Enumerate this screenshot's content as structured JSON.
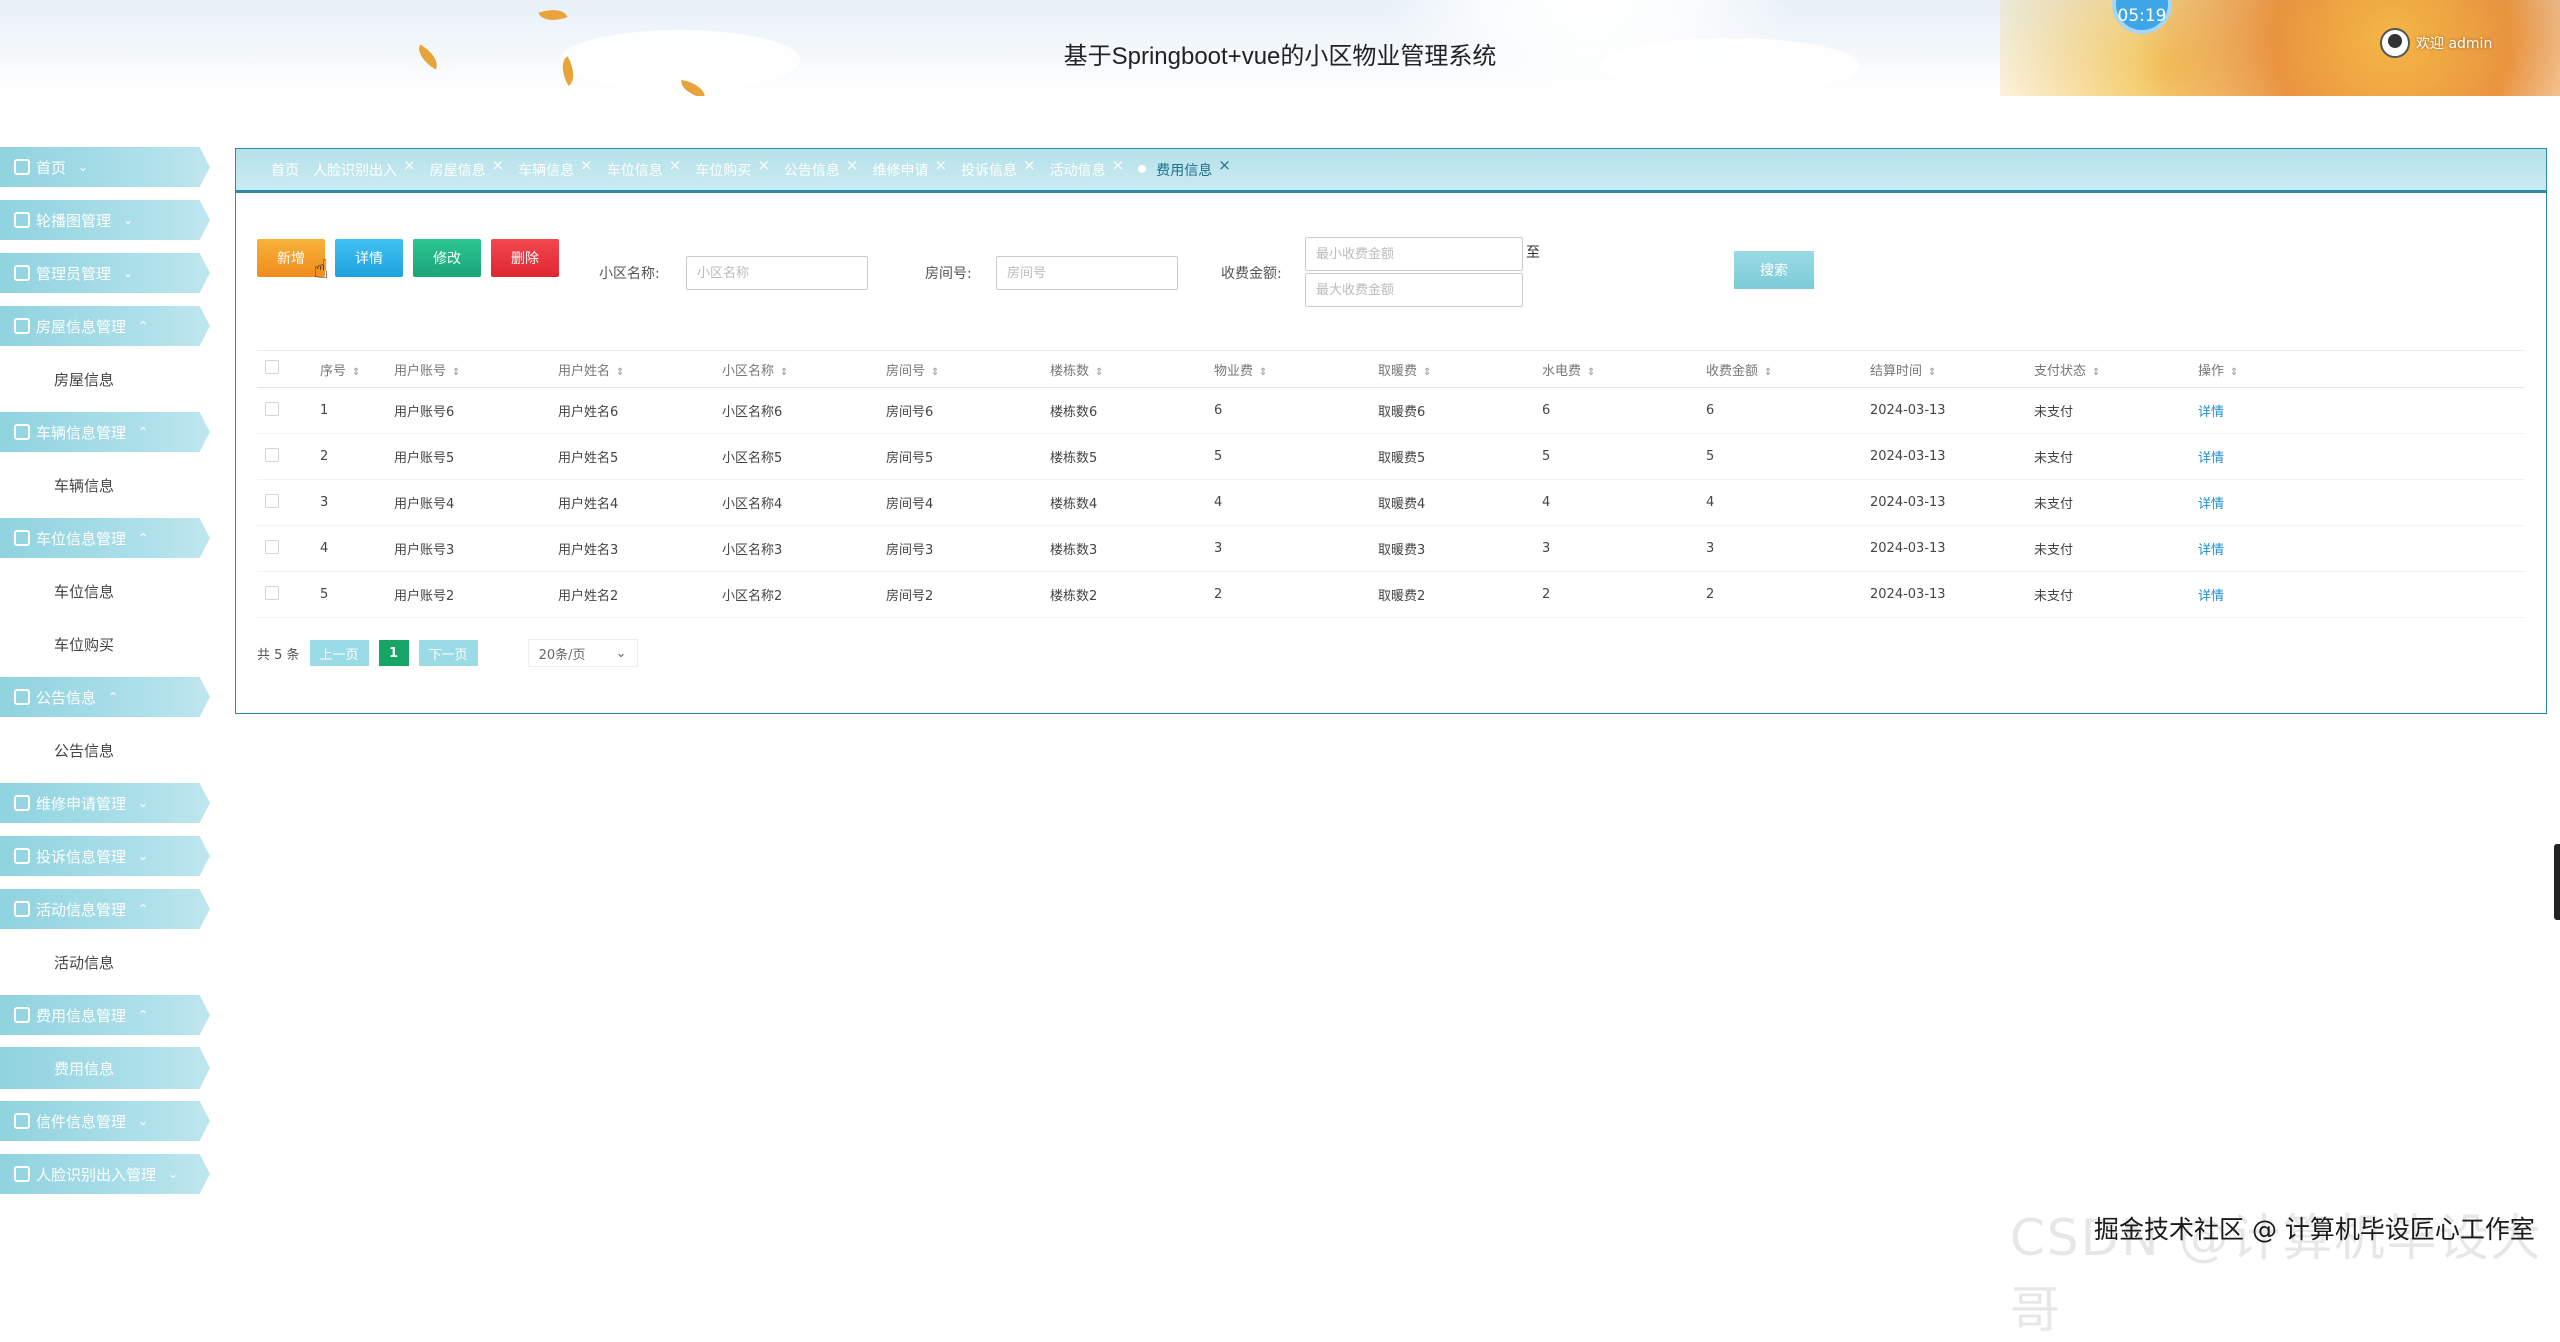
{
  "header": {
    "title": "基于Springboot+vue的小区物业管理系统",
    "clock": "05:19",
    "welcome": "欢迎 admin"
  },
  "sidebar": {
    "items": [
      {
        "type": "group",
        "label": "首页",
        "arrow": "⌄",
        "icon": "home-icon"
      },
      {
        "type": "group",
        "label": "轮播图管理",
        "arrow": "⌄",
        "icon": "image-icon"
      },
      {
        "type": "group",
        "label": "管理员管理",
        "arrow": "⌄",
        "icon": "users-icon"
      },
      {
        "type": "group",
        "label": "房屋信息管理",
        "arrow": "⌃",
        "icon": "house-icon"
      },
      {
        "type": "sub",
        "label": "房屋信息"
      },
      {
        "type": "group",
        "label": "车辆信息管理",
        "arrow": "⌃",
        "icon": "car-icon"
      },
      {
        "type": "sub",
        "label": "车辆信息"
      },
      {
        "type": "group",
        "label": "车位信息管理",
        "arrow": "⌃",
        "icon": "parking-icon"
      },
      {
        "type": "sub",
        "label": "车位信息"
      },
      {
        "type": "sub",
        "label": "车位购买"
      },
      {
        "type": "group",
        "label": "公告信息",
        "arrow": "⌃",
        "icon": "notice-icon"
      },
      {
        "type": "sub",
        "label": "公告信息"
      },
      {
        "type": "group",
        "label": "维修申请管理",
        "arrow": "⌄",
        "icon": "repair-icon"
      },
      {
        "type": "group",
        "label": "投诉信息管理",
        "arrow": "⌄",
        "icon": "complaint-icon"
      },
      {
        "type": "group",
        "label": "活动信息管理",
        "arrow": "⌃",
        "icon": "activity-icon"
      },
      {
        "type": "sub",
        "label": "活动信息"
      },
      {
        "type": "group",
        "label": "费用信息管理",
        "arrow": "⌃",
        "icon": "fee-icon"
      },
      {
        "type": "sub",
        "label": "费用信息",
        "active": true
      },
      {
        "type": "group",
        "label": "信件信息管理",
        "arrow": "⌄",
        "icon": "mail-icon"
      },
      {
        "type": "group",
        "label": "人脸识别出入管理",
        "arrow": "⌄",
        "icon": "face-icon"
      }
    ]
  },
  "tabs": [
    {
      "label": "首页",
      "closable": false
    },
    {
      "label": "人脸识别出入",
      "closable": true
    },
    {
      "label": "房屋信息",
      "closable": true
    },
    {
      "label": "车辆信息",
      "closable": true
    },
    {
      "label": "车位信息",
      "closable": true
    },
    {
      "label": "车位购买",
      "closable": true
    },
    {
      "label": "公告信息",
      "closable": true
    },
    {
      "label": "维修申请",
      "closable": true
    },
    {
      "label": "投诉信息",
      "closable": true
    },
    {
      "label": "活动信息",
      "closable": true
    },
    {
      "label": "费用信息",
      "closable": true,
      "active": true
    }
  ],
  "toolbar": {
    "add": "新增",
    "detail": "详情",
    "edit": "修改",
    "delete": "删除"
  },
  "search": {
    "community_label": "小区名称:",
    "community_placeholder": "小区名称",
    "room_label": "房间号:",
    "room_placeholder": "房间号",
    "amount_label": "收费金额:",
    "amount_min_placeholder": "最小收费金额",
    "amount_max_placeholder": "最大收费金额",
    "range_sep": "至",
    "button": "搜索"
  },
  "table": {
    "columns": [
      "序号",
      "用户账号",
      "用户姓名",
      "小区名称",
      "房间号",
      "楼栋数",
      "物业费",
      "取暖费",
      "水电费",
      "收费金额",
      "结算时间",
      "支付状态",
      "操作"
    ],
    "rows": [
      [
        "1",
        "用户账号6",
        "用户姓名6",
        "小区名称6",
        "房间号6",
        "楼栋数6",
        "6",
        "取暖费6",
        "6",
        "6",
        "2024-03-13",
        "未支付",
        "详情"
      ],
      [
        "2",
        "用户账号5",
        "用户姓名5",
        "小区名称5",
        "房间号5",
        "楼栋数5",
        "5",
        "取暖费5",
        "5",
        "5",
        "2024-03-13",
        "未支付",
        "详情"
      ],
      [
        "3",
        "用户账号4",
        "用户姓名4",
        "小区名称4",
        "房间号4",
        "楼栋数4",
        "4",
        "取暖费4",
        "4",
        "4",
        "2024-03-13",
        "未支付",
        "详情"
      ],
      [
        "4",
        "用户账号3",
        "用户姓名3",
        "小区名称3",
        "房间号3",
        "楼栋数3",
        "3",
        "取暖费3",
        "3",
        "3",
        "2024-03-13",
        "未支付",
        "详情"
      ],
      [
        "5",
        "用户账号2",
        "用户姓名2",
        "小区名称2",
        "房间号2",
        "楼栋数2",
        "2",
        "取暖费2",
        "2",
        "2",
        "2024-03-13",
        "未支付",
        "详情"
      ]
    ]
  },
  "pagination": {
    "total": "共 5 条",
    "prev": "上一页",
    "page": "1",
    "next": "下一页",
    "size": "20条/页"
  },
  "watermark": {
    "text": "掘金技术社区 @ 计算机毕设匠心工作室",
    "bg_text": "CSDN @计算机毕设大哥"
  },
  "colors": {
    "accent": "#8fd3df",
    "border": "#2f8aa8",
    "add": "#f7b23a",
    "detail": "#41c1f2",
    "edit": "#2cc693",
    "delete": "#f2484f",
    "link": "#1e90d2"
  }
}
